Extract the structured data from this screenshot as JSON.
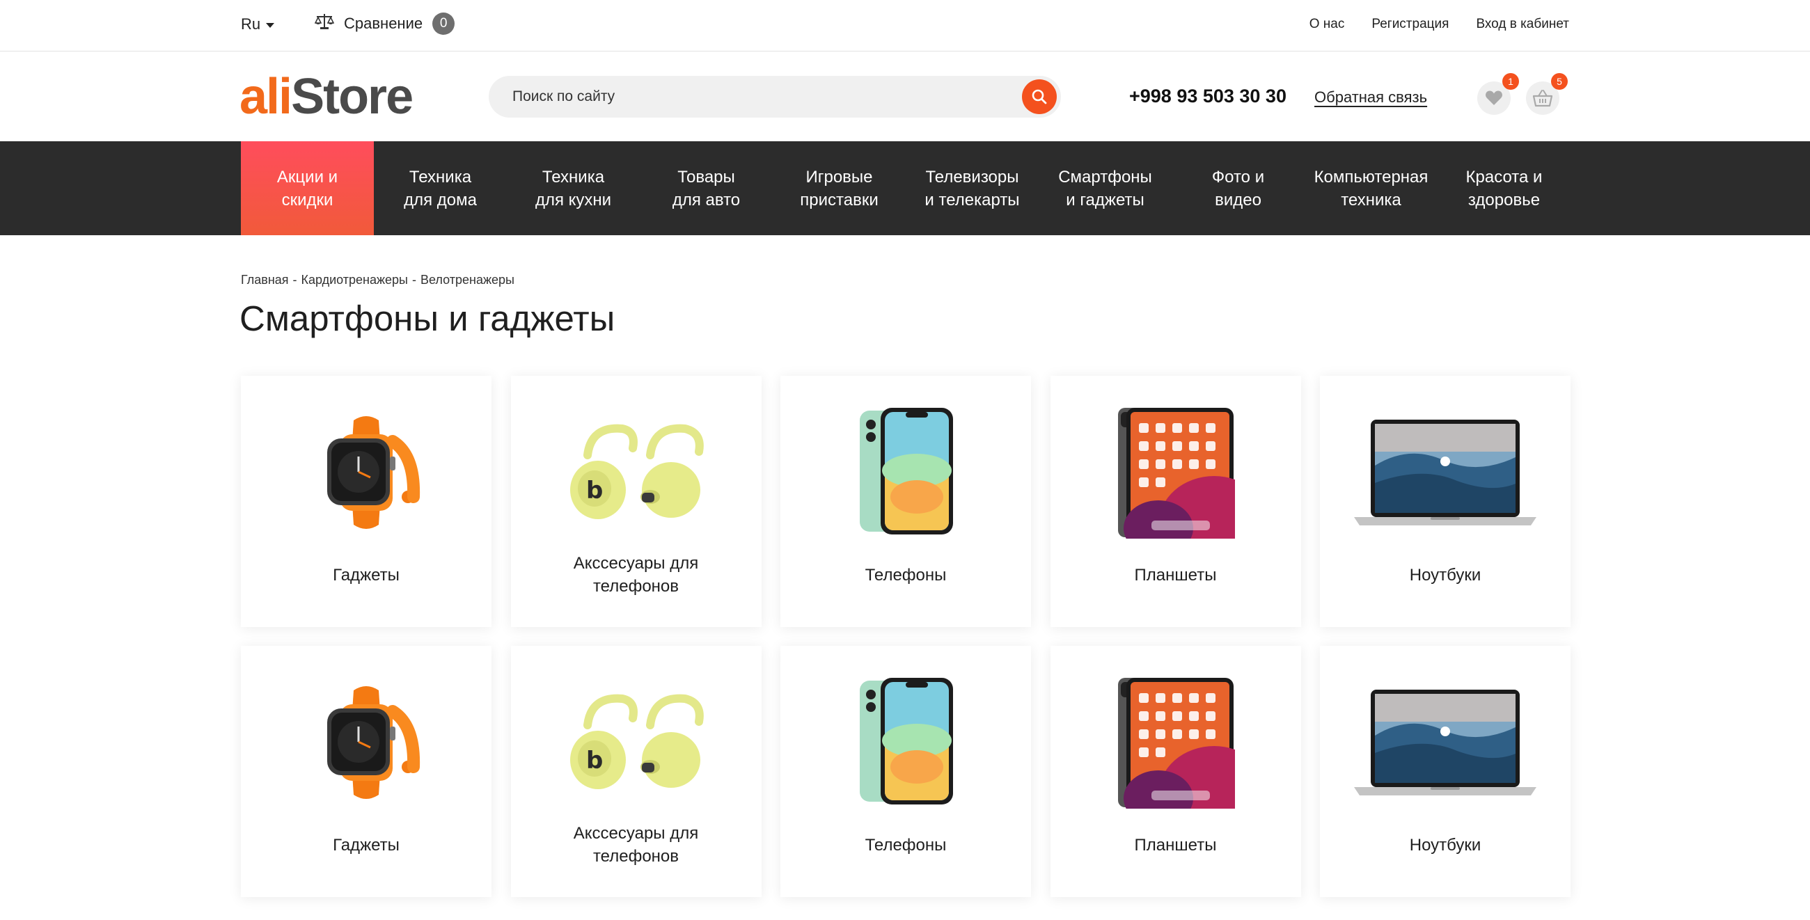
{
  "topbar": {
    "lang": "Ru",
    "compare_label": "Сравнение",
    "compare_count": "0",
    "links": [
      "О нас",
      "Регистрация",
      "Вход в кабинет"
    ]
  },
  "header": {
    "logo_ali": "ali",
    "logo_store": "Store",
    "search_placeholder": "Поиск по сайту",
    "phone": "+998 93 503 30 30",
    "feedback": "Обратная связь",
    "favorites_count": "1",
    "cart_count": "5"
  },
  "nav": [
    {
      "l1": "Акции и",
      "l2": "скидки"
    },
    {
      "l1": "Техника",
      "l2": "для дома"
    },
    {
      "l1": "Техника",
      "l2": "для кухни"
    },
    {
      "l1": "Товары",
      "l2": "для авто"
    },
    {
      "l1": "Игровые",
      "l2": "приставки"
    },
    {
      "l1": "Телевизоры",
      "l2": "и телекарты"
    },
    {
      "l1": "Смартфоны",
      "l2": "и гаджеты"
    },
    {
      "l1": "Фото и",
      "l2": "видео"
    },
    {
      "l1": "Компьютерная",
      "l2": "техника"
    },
    {
      "l1": "Красота и",
      "l2": "здоровье"
    }
  ],
  "breadcrumb": {
    "home": "Главная",
    "level1": "Кардиотренажеры",
    "level2": "Велотренажеры",
    "sep": "-"
  },
  "page_title": "Смартфоны и гаджеты",
  "categories": [
    {
      "label": "Гаджеты",
      "icon": "watch-image"
    },
    {
      "label": "Акссесуары для телефонов",
      "icon": "earbuds-image"
    },
    {
      "label": "Телефоны",
      "icon": "phone-image"
    },
    {
      "label": "Планшеты",
      "icon": "tablet-image"
    },
    {
      "label": "Ноутбуки",
      "icon": "laptop-image"
    },
    {
      "label": "Гаджеты",
      "icon": "watch-image"
    },
    {
      "label": "Акссесуары для телефонов",
      "icon": "earbuds-image"
    },
    {
      "label": "Телефоны",
      "icon": "phone-image"
    },
    {
      "label": "Планшеты",
      "icon": "tablet-image"
    },
    {
      "label": "Ноутбуки",
      "icon": "laptop-image"
    }
  ],
  "colors": {
    "accent": "#f4511e",
    "nav_bg": "#2c2c2c",
    "nav_active_top": "#ff4d5c",
    "nav_active_bottom": "#f15a3a"
  }
}
